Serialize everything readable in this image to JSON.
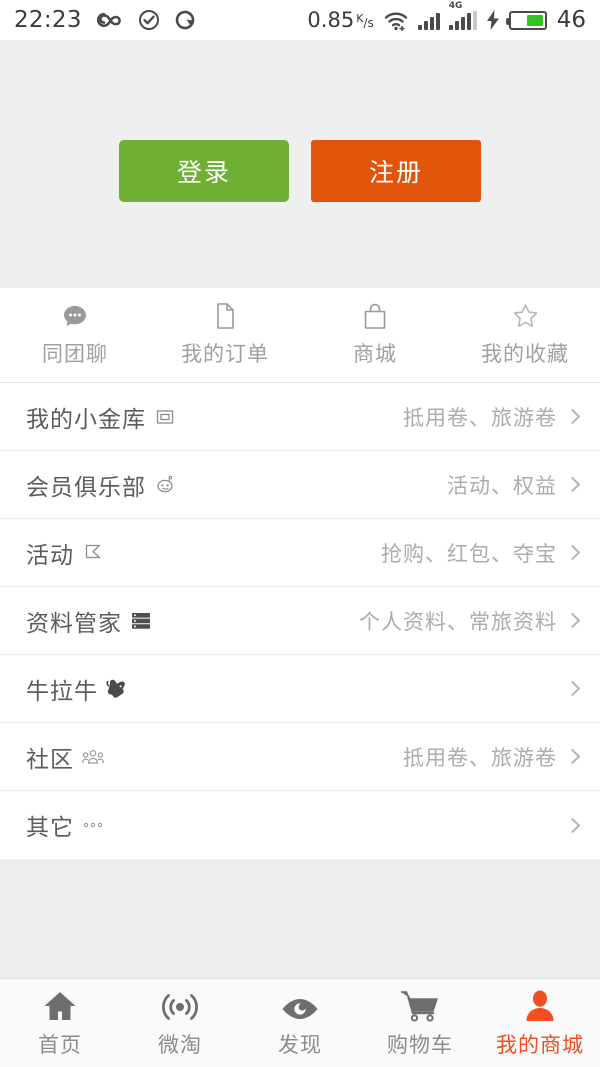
{
  "statusbar": {
    "time": "22:23",
    "icons": [
      "infinity-icon",
      "check-circle-icon",
      "rotate-icon"
    ],
    "net_speed": "0.85",
    "net_speed_unit_num": "K",
    "net_speed_unit_den": "s",
    "wifi": "wifi-icon",
    "signal": "signal-bars-icon",
    "signal_4g_label": "4G",
    "charging": "bolt-icon",
    "battery_level": "46"
  },
  "hero": {
    "login_label": "登录",
    "register_label": "注册",
    "login_color": "#6faf34",
    "register_color": "#e0550a"
  },
  "quick_access": [
    {
      "label": "同团聊",
      "icon": "chat-bubble-icon"
    },
    {
      "label": "我的订单",
      "icon": "document-icon"
    },
    {
      "label": "商城",
      "icon": "shopping-bag-icon"
    },
    {
      "label": "我的收藏",
      "icon": "star-outline-icon"
    }
  ],
  "list": [
    {
      "title": "我的小金库",
      "icon": "safe-box-icon",
      "sub": "抵用卷、旅游卷"
    },
    {
      "title": "会员俱乐部",
      "icon": "alien-face-icon",
      "sub": "活动、权益"
    },
    {
      "title": "活动",
      "icon": "flag-icon",
      "sub": "抢购、红包、夺宝"
    },
    {
      "title": "资料管家",
      "icon": "server-stack-icon",
      "sub": "个人资料、常旅资料"
    },
    {
      "title": "牛拉牛",
      "icon": "bull-head-icon",
      "sub": ""
    },
    {
      "title": "社区",
      "icon": "people-group-icon",
      "sub": "抵用卷、旅游卷"
    },
    {
      "title": "其它",
      "icon": "ellipsis-icon",
      "sub": ""
    }
  ],
  "tabbar": {
    "active_color": "#f04e23",
    "items": [
      {
        "label": "首页",
        "icon": "home-icon",
        "active": false
      },
      {
        "label": "微淘",
        "icon": "broadcast-icon",
        "active": false
      },
      {
        "label": "发现",
        "icon": "eye-icon",
        "active": false
      },
      {
        "label": "购物车",
        "icon": "cart-icon",
        "active": false
      },
      {
        "label": "我的商城",
        "icon": "person-icon",
        "active": true
      }
    ]
  }
}
